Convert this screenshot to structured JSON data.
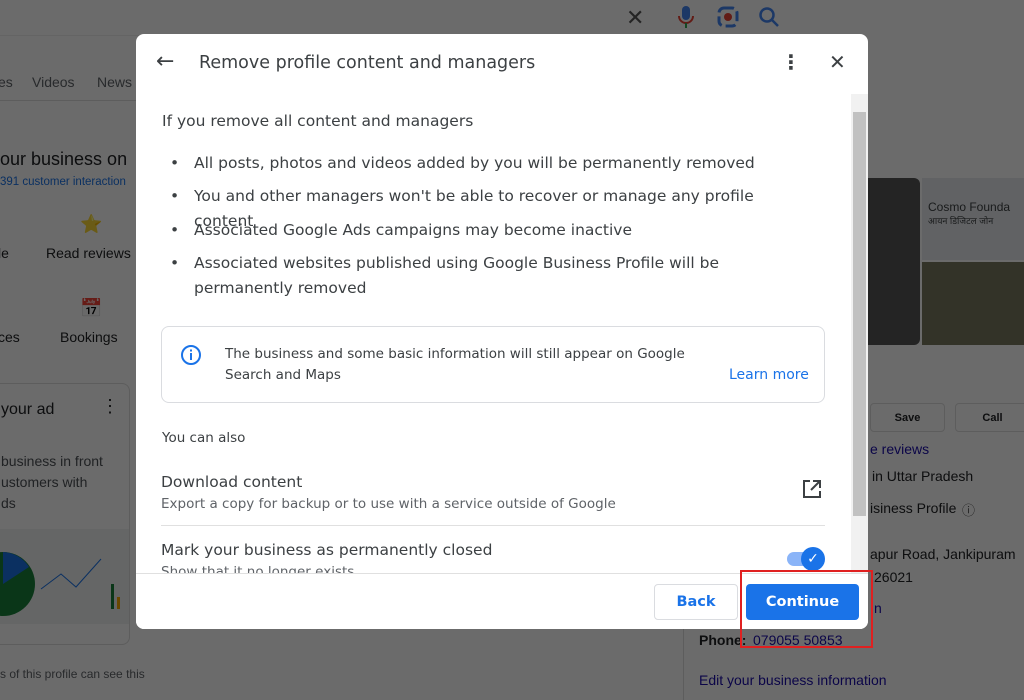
{
  "background": {
    "tabs": [
      "es",
      "Videos",
      "News"
    ],
    "heading": "our business on",
    "interactions": "391 customer interaction",
    "actions": [
      {
        "label": "le"
      },
      {
        "label": "Read reviews"
      },
      {
        "label": "ces"
      },
      {
        "label": "Bookings"
      }
    ],
    "ad_card": {
      "title": "your ad",
      "lines": [
        "business in front",
        "ustomers with",
        "ds"
      ]
    },
    "footer_note": "s of this profile can see this",
    "right": {
      "map_label": "Cosmo Founda",
      "map_label_hi": "आयन डिजिटल जोन",
      "save": "Save",
      "call": "Call",
      "reviews": "e reviews",
      "region": "in Uttar Pradesh",
      "profile": "isiness Profile",
      "address1": "apur Road, Jankipuram",
      "address2": "26021",
      "hours": "n",
      "phone_label": "Phone:",
      "phone": "079055 50853",
      "edit": "Edit your business information"
    }
  },
  "dialog": {
    "title": "Remove profile content and managers",
    "section_title": "If you remove all content and managers",
    "bullets": [
      "All posts, photos and videos added by you will be permanently removed",
      "You and other managers won't be able to recover or manage any profile content",
      "Associated Google Ads campaigns may become inactive",
      "Associated websites published using Google Business Profile will be permanently removed"
    ],
    "info_text": "The business and some basic information will still appear on Google Search and Maps",
    "learn_more": "Learn more",
    "also_title": "You can also",
    "download_title": "Download content",
    "download_desc": "Export a copy for backup or to use with a service outside of Google",
    "close_title": "Mark your business as permanently closed",
    "close_desc": "Show that it no longer exists",
    "close_toggle_on": true,
    "back": "Back",
    "continue": "Continue"
  }
}
